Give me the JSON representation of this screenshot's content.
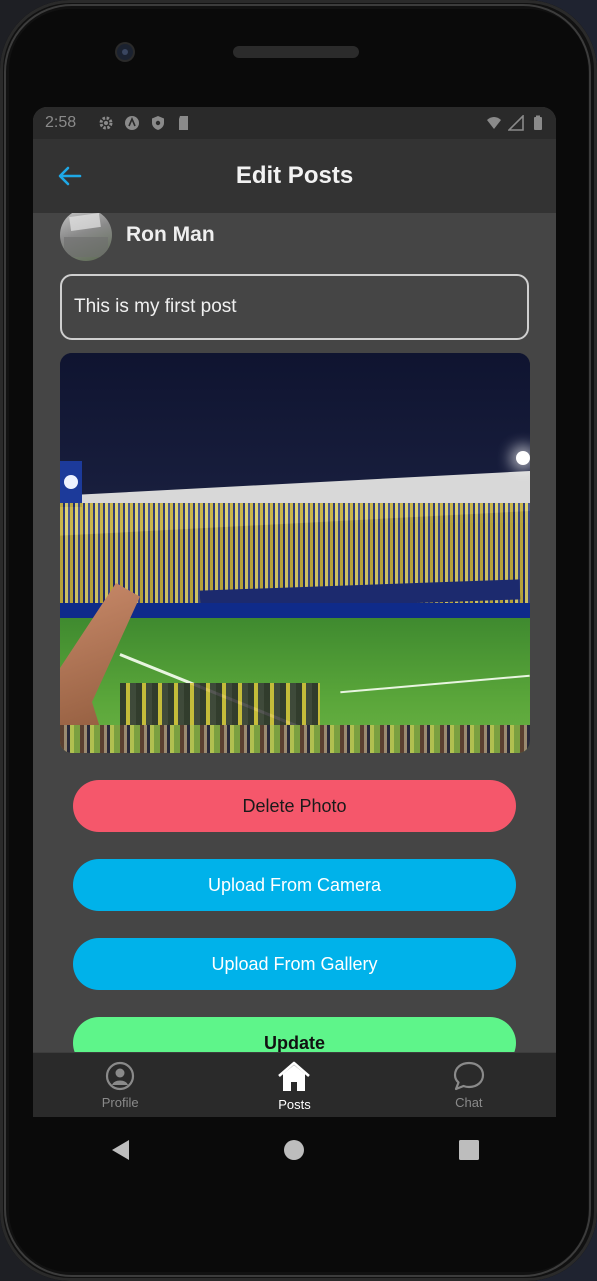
{
  "status_bar": {
    "time": "2:58"
  },
  "header": {
    "title": "Edit Posts"
  },
  "post": {
    "author": "Ron Man",
    "text_value": "This is my first post"
  },
  "buttons": {
    "delete": "Delete Photo",
    "camera": "Upload From Camera",
    "gallery": "Upload From Gallery",
    "update": "Update"
  },
  "bottom_nav": {
    "items": [
      {
        "label": "Profile",
        "icon": "profile-icon",
        "active": false
      },
      {
        "label": "Posts",
        "icon": "home-icon",
        "active": true
      },
      {
        "label": "Chat",
        "icon": "chat-icon",
        "active": false
      }
    ]
  },
  "colors": {
    "accent_blue": "#00b2ea",
    "delete_red": "#f5576b",
    "update_green": "#5ef58a",
    "back_arrow": "#1fa8e6",
    "screen_bg": "#454545",
    "header_bg": "#333333"
  }
}
